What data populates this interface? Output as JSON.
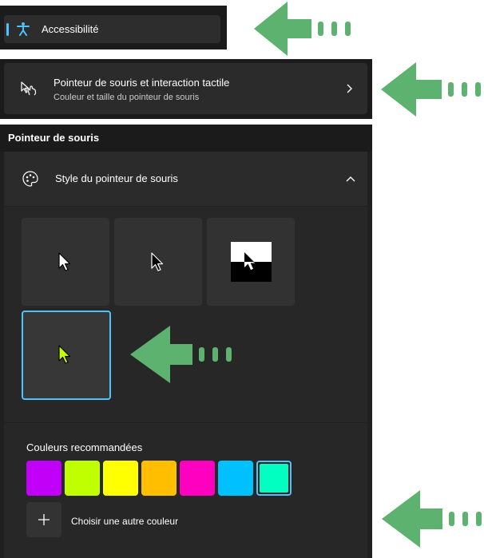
{
  "nav": {
    "accessibility_label": "Accessibilité"
  },
  "setting_row": {
    "title": "Pointeur de souris et interaction tactile",
    "subtitle": "Couleur et taille du pointeur de souris"
  },
  "section": {
    "title": "Pointeur de souris",
    "expander_label": "Style du pointeur de souris",
    "pointer_styles": [
      {
        "name": "Blanc",
        "selected": false
      },
      {
        "name": "Noir",
        "selected": false
      },
      {
        "name": "Inversé",
        "selected": false
      },
      {
        "name": "Personnalisé",
        "selected": true
      }
    ],
    "recommended_label": "Couleurs recommandées",
    "recommended_colors": [
      "#c100f7",
      "#bfff00",
      "#ffff00",
      "#ffbf00",
      "#ff00c1",
      "#00c0ff",
      "#00ffc1"
    ],
    "selected_color": "#00ffc1",
    "custom_color_label": "Choisir une autre couleur"
  },
  "colors": {
    "accent": "#4cc2ff",
    "annotation_arrow": "#5cb26e",
    "custom_pointer": "#c8ff00"
  }
}
